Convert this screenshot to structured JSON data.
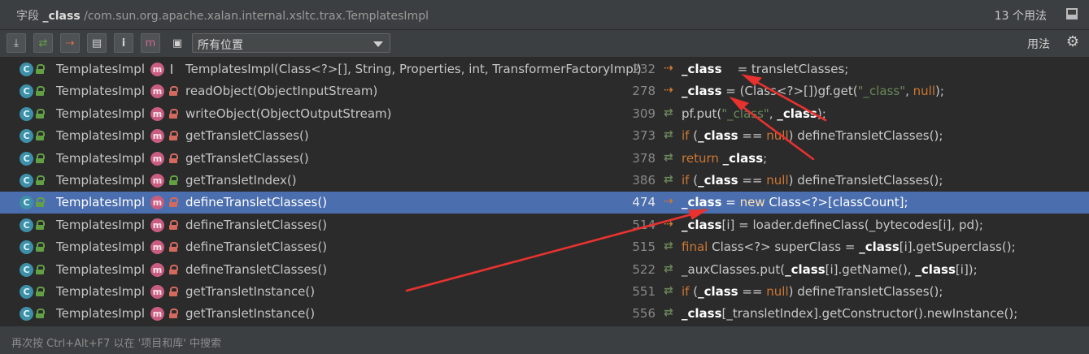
{
  "title": {
    "prefix": "字段 ",
    "field": "_class",
    "path": " /com.sun.org.apache.xalan.internal.xsltc.trax.TemplatesImpl",
    "usage_count": "13 个用法"
  },
  "toolbar": {
    "scope_value": "所有位置",
    "usages_label": "用法"
  },
  "rows": [
    {
      "cls": "TemplatesImpl",
      "method": "TemplatesImpl(Class<?>[], String, Properties, int, TransformerFactoryImpl)",
      "line": "232",
      "access": "write",
      "vis": "pkg",
      "code": [
        {
          "t": "_class",
          "s": "hl"
        },
        {
          "t": "    = transletClasses;",
          "s": ""
        }
      ]
    },
    {
      "cls": "TemplatesImpl",
      "method": "readObject(ObjectInputStream)",
      "line": "278",
      "access": "write",
      "vis": "priv",
      "code": [
        {
          "t": "_class",
          "s": "hl"
        },
        {
          "t": " = (Class<?>[])gf.get(",
          "s": ""
        },
        {
          "t": "\"_class\"",
          "s": "str"
        },
        {
          "t": ", ",
          "s": ""
        },
        {
          "t": "null",
          "s": "kwd"
        },
        {
          "t": ");",
          "s": ""
        }
      ]
    },
    {
      "cls": "TemplatesImpl",
      "method": "writeObject(ObjectOutputStream)",
      "line": "309",
      "access": "read",
      "vis": "priv",
      "code": [
        {
          "t": "pf.put(",
          "s": ""
        },
        {
          "t": "\"_class\"",
          "s": "str"
        },
        {
          "t": ", ",
          "s": ""
        },
        {
          "t": "_class",
          "s": "hl"
        },
        {
          "t": ");",
          "s": ""
        }
      ]
    },
    {
      "cls": "TemplatesImpl",
      "method": "getTransletClasses()",
      "line": "373",
      "access": "read",
      "vis": "priv",
      "code": [
        {
          "t": "if ",
          "s": "kwd"
        },
        {
          "t": "(",
          "s": ""
        },
        {
          "t": "_class",
          "s": "hl"
        },
        {
          "t": " == ",
          "s": ""
        },
        {
          "t": "null",
          "s": "kwd"
        },
        {
          "t": ") defineTransletClasses();",
          "s": ""
        }
      ]
    },
    {
      "cls": "TemplatesImpl",
      "method": "getTransletClasses()",
      "line": "378",
      "access": "read",
      "vis": "priv",
      "code": [
        {
          "t": "return ",
          "s": "kwd"
        },
        {
          "t": "_class",
          "s": "hl"
        },
        {
          "t": ";",
          "s": ""
        }
      ]
    },
    {
      "cls": "TemplatesImpl",
      "method": "getTransletIndex()",
      "line": "386",
      "access": "read",
      "vis": "pub",
      "code": [
        {
          "t": "if ",
          "s": "kwd"
        },
        {
          "t": "(",
          "s": ""
        },
        {
          "t": "_class",
          "s": "hl"
        },
        {
          "t": " == ",
          "s": ""
        },
        {
          "t": "null",
          "s": "kwd"
        },
        {
          "t": ") defineTransletClasses();",
          "s": ""
        }
      ]
    },
    {
      "cls": "TemplatesImpl",
      "method": "defineTransletClasses()",
      "line": "474",
      "access": "write",
      "vis": "priv",
      "selected": true,
      "code": [
        {
          "t": "_class",
          "s": "hl"
        },
        {
          "t": " = ",
          "s": ""
        },
        {
          "t": "new ",
          "s": "kwd"
        },
        {
          "t": "Class<?>[classCount];",
          "s": ""
        }
      ]
    },
    {
      "cls": "TemplatesImpl",
      "method": "defineTransletClasses()",
      "line": "514",
      "access": "write",
      "vis": "priv",
      "code": [
        {
          "t": "_class",
          "s": "hl"
        },
        {
          "t": "[i] = loader.defineClass(_bytecodes[i], pd);",
          "s": ""
        }
      ]
    },
    {
      "cls": "TemplatesImpl",
      "method": "defineTransletClasses()",
      "line": "515",
      "access": "read",
      "vis": "priv",
      "code": [
        {
          "t": "final ",
          "s": "kwd"
        },
        {
          "t": "Class<?> superClass = ",
          "s": ""
        },
        {
          "t": "_class",
          "s": "hl"
        },
        {
          "t": "[i].getSuperclass();",
          "s": ""
        }
      ]
    },
    {
      "cls": "TemplatesImpl",
      "method": "defineTransletClasses()",
      "line": "522",
      "access": "read",
      "vis": "priv",
      "code": [
        {
          "t": "_auxClasses.put(",
          "s": ""
        },
        {
          "t": "_class",
          "s": "hl"
        },
        {
          "t": "[i].getName(), ",
          "s": ""
        },
        {
          "t": "_class",
          "s": "hl"
        },
        {
          "t": "[i]);",
          "s": ""
        }
      ]
    },
    {
      "cls": "TemplatesImpl",
      "method": "getTransletInstance()",
      "line": "551",
      "access": "read",
      "vis": "priv",
      "code": [
        {
          "t": "if ",
          "s": "kwd"
        },
        {
          "t": "(",
          "s": ""
        },
        {
          "t": "_class",
          "s": "hl"
        },
        {
          "t": " == ",
          "s": ""
        },
        {
          "t": "null",
          "s": "kwd"
        },
        {
          "t": ") defineTransletClasses();",
          "s": ""
        }
      ]
    },
    {
      "cls": "TemplatesImpl",
      "method": "getTransletInstance()",
      "line": "556",
      "access": "read",
      "vis": "priv",
      "code": [
        {
          "t": "_class",
          "s": "hl"
        },
        {
          "t": "[_transletIndex].getConstructor().newInstance();",
          "s": ""
        }
      ]
    }
  ],
  "footer": {
    "hint": "再次按 Ctrl+Alt+F7 以在 '项目和库' 中搜索"
  },
  "colors": {
    "selection": "#4b6eaf",
    "annotation_arrow": "#e8322f",
    "keyword": "#cc7832",
    "string": "#6a8759"
  }
}
